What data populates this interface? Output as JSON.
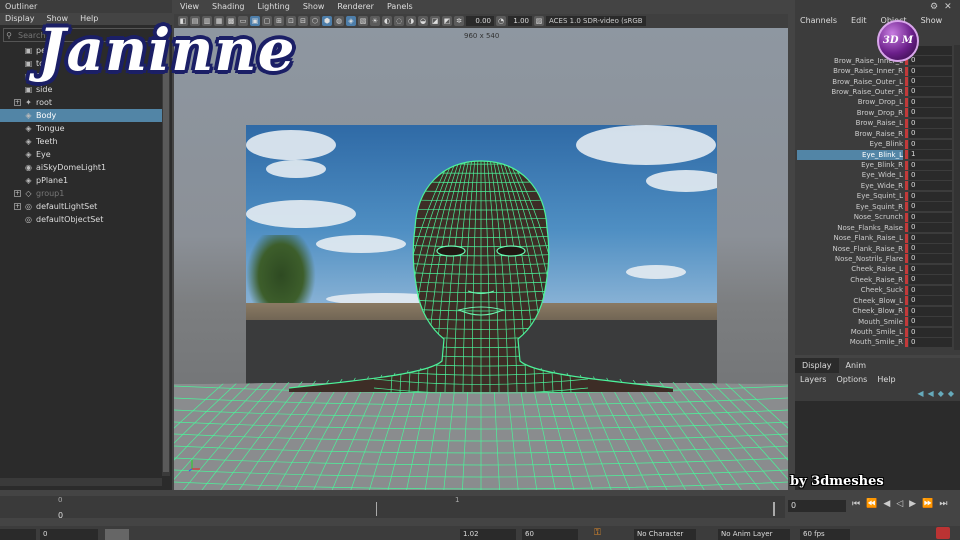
{
  "outliner": {
    "title": "Outliner",
    "menu": [
      "Display",
      "Show",
      "Help"
    ],
    "search_placeholder": "Search...",
    "items": [
      {
        "label": "persp",
        "dim": false
      },
      {
        "label": "top",
        "dim": false
      },
      {
        "label": "front",
        "dim": false
      },
      {
        "label": "side",
        "dim": false
      },
      {
        "label": "root",
        "dim": false
      },
      {
        "label": "Body",
        "dim": false
      },
      {
        "label": "Tongue",
        "dim": false
      },
      {
        "label": "Teeth",
        "dim": false
      },
      {
        "label": "Eye",
        "dim": false
      },
      {
        "label": "aiSkyDomeLight1",
        "dim": false
      },
      {
        "label": "pPlane1",
        "dim": false
      },
      {
        "label": "group1",
        "dim": true
      },
      {
        "label": "defaultLightSet",
        "dim": false
      },
      {
        "label": "defaultObjectSet",
        "dim": false
      }
    ]
  },
  "viewport": {
    "menu": [
      "View",
      "Shading",
      "Lighting",
      "Show",
      "Renderer",
      "Panels"
    ],
    "exposure": "0.00",
    "gamma": "1.00",
    "colorspace": "ACES 1.0 SDR-video (sRGB",
    "resolution_gate": "960 x 540"
  },
  "channels": {
    "menu": [
      "Channels",
      "Edit",
      "Object",
      "Show"
    ],
    "rows": [
      {
        "name": "Lip",
        "value": "0"
      },
      {
        "name": "Brow_Raise_Inner_L",
        "value": "0"
      },
      {
        "name": "Brow_Raise_Inner_R",
        "value": "0"
      },
      {
        "name": "Brow_Raise_Outer_L",
        "value": "0"
      },
      {
        "name": "Brow_Raise_Outer_R",
        "value": "0"
      },
      {
        "name": "Brow_Drop_L",
        "value": "0"
      },
      {
        "name": "Brow_Drop_R",
        "value": "0"
      },
      {
        "name": "Brow_Raise_L",
        "value": "0"
      },
      {
        "name": "Brow_Raise_R",
        "value": "0"
      },
      {
        "name": "Eye_Blink",
        "value": "0"
      },
      {
        "name": "Eye_Blink_L",
        "value": "1",
        "selected": true
      },
      {
        "name": "Eye_Blink_R",
        "value": "0"
      },
      {
        "name": "Eye_Wide_L",
        "value": "0"
      },
      {
        "name": "Eye_Wide_R",
        "value": "0"
      },
      {
        "name": "Eye_Squint_L",
        "value": "0"
      },
      {
        "name": "Eye_Squint_R",
        "value": "0"
      },
      {
        "name": "Nose_Scrunch",
        "value": "0"
      },
      {
        "name": "Nose_Flanks_Raise",
        "value": "0"
      },
      {
        "name": "Nose_Flank_Raise_L",
        "value": "0"
      },
      {
        "name": "Nose_Flank_Raise_R",
        "value": "0"
      },
      {
        "name": "Nose_Nostrils_Flare",
        "value": "0"
      },
      {
        "name": "Cheek_Raise_L",
        "value": "0"
      },
      {
        "name": "Cheek_Raise_R",
        "value": "0"
      },
      {
        "name": "Cheek_Suck",
        "value": "0"
      },
      {
        "name": "Cheek_Blow_L",
        "value": "0"
      },
      {
        "name": "Cheek_Blow_R",
        "value": "0"
      },
      {
        "name": "Mouth_Smile",
        "value": "0"
      },
      {
        "name": "Mouth_Smile_L",
        "value": "0"
      },
      {
        "name": "Mouth_Smile_R",
        "value": "0"
      }
    ]
  },
  "logo_text": "3D M",
  "layers": {
    "tabs": [
      "Display",
      "Anim"
    ],
    "menu": [
      "Layers",
      "Options",
      "Help"
    ]
  },
  "watermark": {
    "title": "Janinne",
    "credit": "by 3dmeshes"
  },
  "timeline": {
    "start_tick": "0",
    "mid_tick": "1",
    "current": "0",
    "current_frame_field": "0"
  },
  "range": {
    "start": "0",
    "end_value": "1.02",
    "end": "60",
    "character_set": "No Character Set",
    "anim_layer": "No Anim Layer",
    "fps": "60 fps"
  },
  "colors": {
    "selection": "#5285a6",
    "wire": "#4cf29a",
    "key_bar": "#c23a3a"
  }
}
